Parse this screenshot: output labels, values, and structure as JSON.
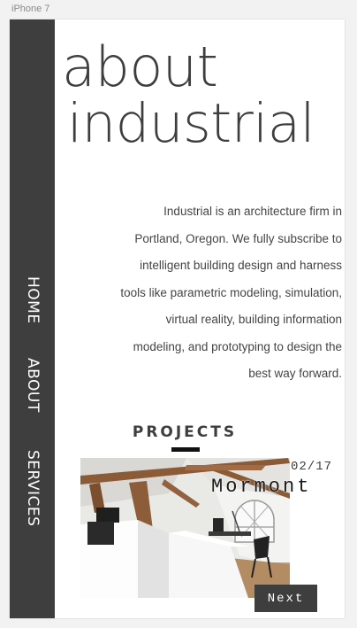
{
  "device": {
    "label": "iPhone 7"
  },
  "nav": {
    "items": [
      {
        "label": "HOME"
      },
      {
        "label": "ABOUT"
      },
      {
        "label": "SERVICES"
      }
    ]
  },
  "header": {
    "title_line_1": "about",
    "title_line_2": "industrial"
  },
  "intro": {
    "text": "Industrial is an architecture firm in Portland, Oregon.  We fully subscribe to intelligent building design and harness tools like parametric modeling, simulation, virtual reality, building information modeling, and prototyping to design the best way forward."
  },
  "projects": {
    "heading": "PROJECTS",
    "current": {
      "index": "02/17",
      "name": "Mormont"
    },
    "next_label": "Next"
  },
  "colors": {
    "sidebar": "#3e3e3e",
    "text": "#3e3e3e",
    "accent": "#111111",
    "background": "#ffffff"
  }
}
